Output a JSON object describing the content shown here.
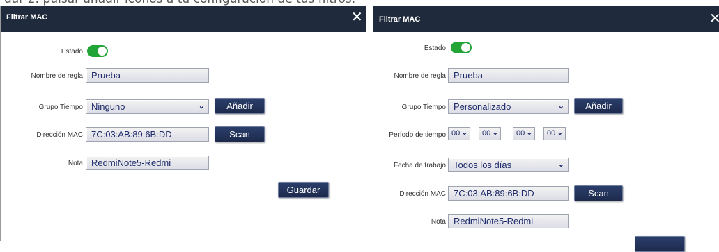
{
  "caption": "dar 2: pulsar añadir iconos a tu configuración de tus filtros.",
  "left_dialog": {
    "title": "Filtrar MAC",
    "close_glyph": "✕",
    "estado_label": "Estado",
    "estado_on": true,
    "rule_name_label": "Nombre de regla",
    "rule_name_value": "Prueba",
    "time_group_label": "Grupo Tiempo",
    "time_group_value": "Ninguno",
    "add_button": "Añadir",
    "mac_label": "Dirección MAC",
    "mac_value": "7C:03:AB:89:6B:DD",
    "scan_button": "Scan",
    "note_label": "Nota",
    "note_value": "RedmiNote5-Redmi",
    "save_button": "Guardar"
  },
  "right_dialog": {
    "title": "Filtrar MAC",
    "close_glyph": "✕",
    "estado_label": "Estado",
    "estado_on": true,
    "rule_name_label": "Nombre de regla",
    "rule_name_value": "Prueba",
    "time_group_label": "Grupo Tiempo",
    "time_group_value": "Personalizado",
    "add_button": "Añadir",
    "period_label": "Período de tiempo",
    "period_values": [
      "00",
      "00",
      "00",
      "00"
    ],
    "work_date_label": "Fecha de trabajo",
    "work_date_value": "Todos los días",
    "mac_label": "Dirección MAC",
    "mac_value": "7C:03:AB:89:6B:DD",
    "scan_button": "Scan",
    "note_label": "Nota",
    "note_value": "RedmiNote5-Redmi"
  },
  "colors": {
    "titlebar": "#1f2a3c",
    "toggle_on": "#22a536",
    "button": "#1d2a4c"
  }
}
